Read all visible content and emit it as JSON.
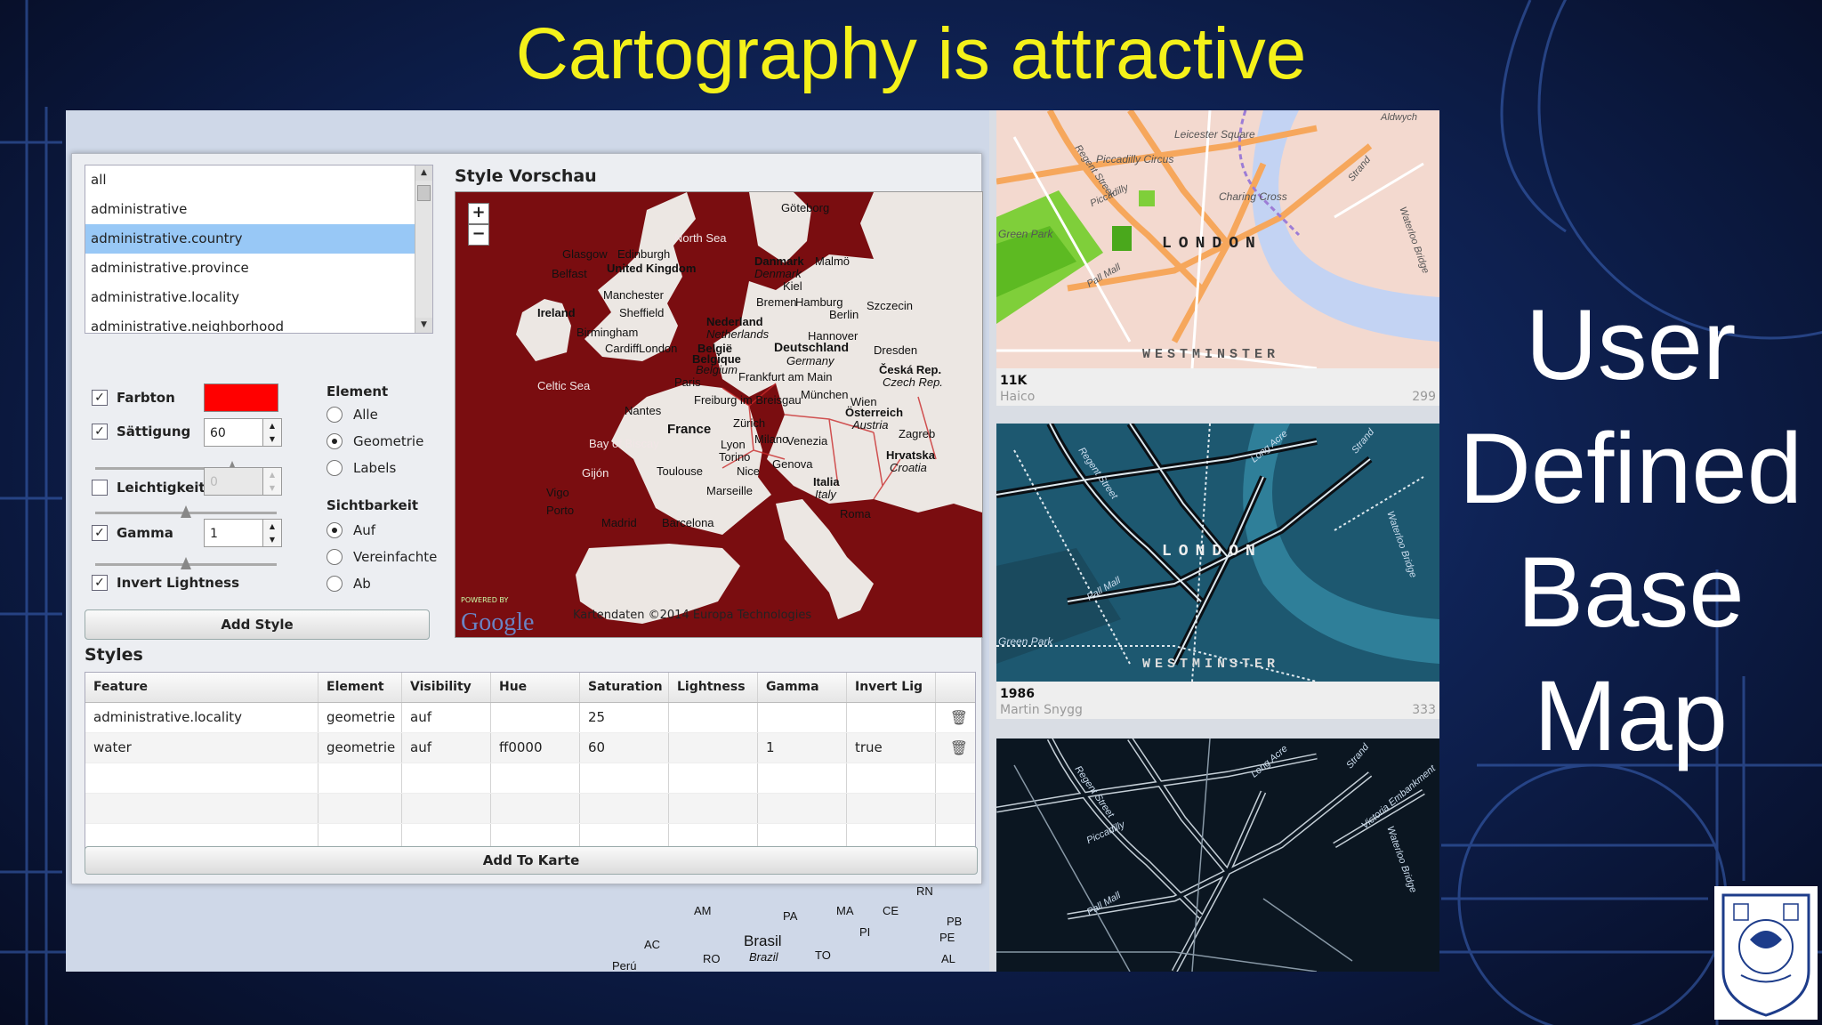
{
  "slide": {
    "title": "Cartography is attractive",
    "side_title": [
      "User",
      "Defined",
      "Base",
      "Map"
    ]
  },
  "style_editor": {
    "layers": [
      "all",
      "administrative",
      "administrative.country",
      "administrative.province",
      "administrative.locality",
      "administrative.neighborhood"
    ],
    "selected_layer": "administrative.country",
    "farbton": {
      "label": "Farbton",
      "checked": true,
      "color": "#ff0000"
    },
    "saettigung": {
      "label": "Sättigung",
      "checked": true,
      "value": "60"
    },
    "leichtigkeit": {
      "label": "Leichtigkeit",
      "checked": false,
      "value": "0"
    },
    "gamma": {
      "label": "Gamma",
      "checked": true,
      "value": "1"
    },
    "invert": {
      "label": "Invert Lightness",
      "checked": true
    },
    "element_group": {
      "title": "Element",
      "options": [
        "Alle",
        "Geometrie",
        "Labels"
      ],
      "selected": "Geometrie"
    },
    "sichtbarkeit_group": {
      "title": "Sichtbarkeit",
      "options": [
        "Auf",
        "Vereinfachte",
        "Ab"
      ],
      "selected": "Auf"
    },
    "add_style_label": "Add Style",
    "preview_label": "Style Vorschau",
    "map": {
      "labels": [
        "North Sea",
        "Glasgow",
        "Edinburgh",
        "United Kingdom",
        "Belfast",
        "Ireland",
        "Manchester",
        "Sheffield",
        "Birmingham",
        "Cardiff",
        "London",
        "Celtic Sea",
        "Bay of Biscay",
        "Nantes",
        "Paris",
        "France",
        "Toulouse",
        "Gijón",
        "Vigo",
        "Porto",
        "Madrid",
        "Barcelona",
        "Marseille",
        "Lyon",
        "Nice",
        "Genova",
        "Torino",
        "Milano",
        "Venezia",
        "Zürich",
        "Freiburg im Breisgau",
        "Frankfurt am Main",
        "München",
        "Wien",
        "Österreich",
        "Austria",
        "Deutschland",
        "Germany",
        "Hamburg",
        "Bremen",
        "Berlin",
        "Hannover",
        "Nederland",
        "Netherlands",
        "België",
        "Belgique",
        "Belgium",
        "Danmark",
        "Denmark",
        "Kiel",
        "Göteborg",
        "Malmö",
        "Szczecin",
        "Dresden",
        "Česká Rep.",
        "Czech Rep.",
        "Zagreb",
        "Hrvatska",
        "Croatia",
        "Italia",
        "Italy",
        "Roma"
      ],
      "powered_by": "POWERED BY",
      "google": "Google",
      "attribution": "Kartendaten ©2014 Europa Technologies"
    },
    "styles_title": "Styles",
    "table": {
      "columns": [
        "Feature",
        "Element",
        "Visibility",
        "Hue",
        "Saturation",
        "Lightness",
        "Gamma",
        "Invert Lig"
      ],
      "rows": [
        [
          "administrative.locality",
          "geometrie",
          "auf",
          "",
          "25",
          "",
          "",
          ""
        ],
        [
          "water",
          "geometrie",
          "auf",
          "ff0000",
          "60",
          "",
          "1",
          "true"
        ]
      ]
    },
    "add_to_karte_label": "Add To Karte",
    "underlay_labels": [
      "AM",
      "PA",
      "MA",
      "CE",
      "RN",
      "PB",
      "PE",
      "PI",
      "AL",
      "AC",
      "Brasil",
      "Brazil",
      "RO",
      "TO",
      "Perú"
    ]
  },
  "tiles": [
    {
      "name": "LONDON",
      "district": "WESTMINSTER",
      "title": "11K",
      "author": "Haico",
      "count": "299",
      "labels": [
        "Leicester Square",
        "Piccadilly Circus",
        "Regent Street",
        "Piccadilly",
        "Charing Cross",
        "Strand",
        "Green Park",
        "Pall Mall",
        "Aldwych",
        "Waterloo Bridge"
      ]
    },
    {
      "name": "LONDON",
      "district": "WESTMINSTER",
      "title": "1986",
      "author": "Martin Snygg",
      "count": "333",
      "labels": [
        "Regent Street",
        "Long Acre",
        "Strand",
        "Green Park",
        "Pall Mall",
        "Waterloo Bridge"
      ]
    },
    {
      "name": "",
      "district": "",
      "title": "",
      "author": "",
      "count": "",
      "labels": [
        "Regent Street",
        "Piccadilly",
        "Long Acre",
        "Strand",
        "Victoria Embankment",
        "Waterloo Bridge",
        "Pall Mall"
      ]
    }
  ]
}
